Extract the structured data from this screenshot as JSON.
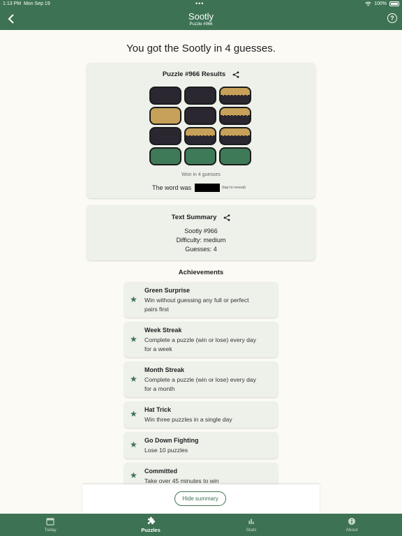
{
  "status_bar": {
    "time": "1:13 PM",
    "date": "Mon Sep 19",
    "battery": "100%"
  },
  "header": {
    "title": "Sootly",
    "subtitle": "Puzzle #966"
  },
  "headline": "You got the Sootly in 4 guesses.",
  "results": {
    "title": "Puzzle #966 Results",
    "grid": [
      [
        "dark",
        "dark",
        "half"
      ],
      [
        "tan",
        "dark",
        "half"
      ],
      [
        "dark",
        "half",
        "half"
      ],
      [
        "green",
        "green",
        "green"
      ]
    ],
    "won_text": "Won in 4 guesses",
    "word_label": "The word was",
    "tap_reveal": "(tap to reveal)"
  },
  "summary": {
    "title": "Text Summary",
    "lines": [
      "Sootly #966",
      "Difficulty: medium",
      "Guesses: 4"
    ]
  },
  "achievements": {
    "heading": "Achievements",
    "items": [
      {
        "name": "Green Surprise",
        "desc_lines": [
          "Win without guessing any full or perfect",
          "pairs first"
        ]
      },
      {
        "name": "Week Streak",
        "desc_lines": [
          "Complete a puzzle (win or lose) every day",
          "for a week"
        ]
      },
      {
        "name": "Month Streak",
        "desc_lines": [
          "Complete a puzzle (win or lose) every day",
          "for a month"
        ]
      },
      {
        "name": "Hat Trick",
        "desc_lines": [
          "Win three puzzles in a single day"
        ]
      },
      {
        "name": "Go Down Fighting",
        "desc_lines": [
          "Lose 10 puzzles"
        ]
      },
      {
        "name": "Committed",
        "desc_lines": [
          "Take over 45 minutes to win"
        ]
      }
    ]
  },
  "hide_summary_label": "Hide summary",
  "tabs": [
    {
      "label": "Today",
      "icon": "calendar-icon",
      "active": false
    },
    {
      "label": "Puzzles",
      "icon": "puzzle-icon",
      "active": true
    },
    {
      "label": "Stats",
      "icon": "bar-chart-icon",
      "active": false
    },
    {
      "label": "About",
      "icon": "info-icon",
      "active": false
    }
  ],
  "colors": {
    "brand": "#3e7254",
    "tile_dark": "#2b2731",
    "tile_tan": "#c7a159",
    "tile_green": "#3e7a58"
  }
}
